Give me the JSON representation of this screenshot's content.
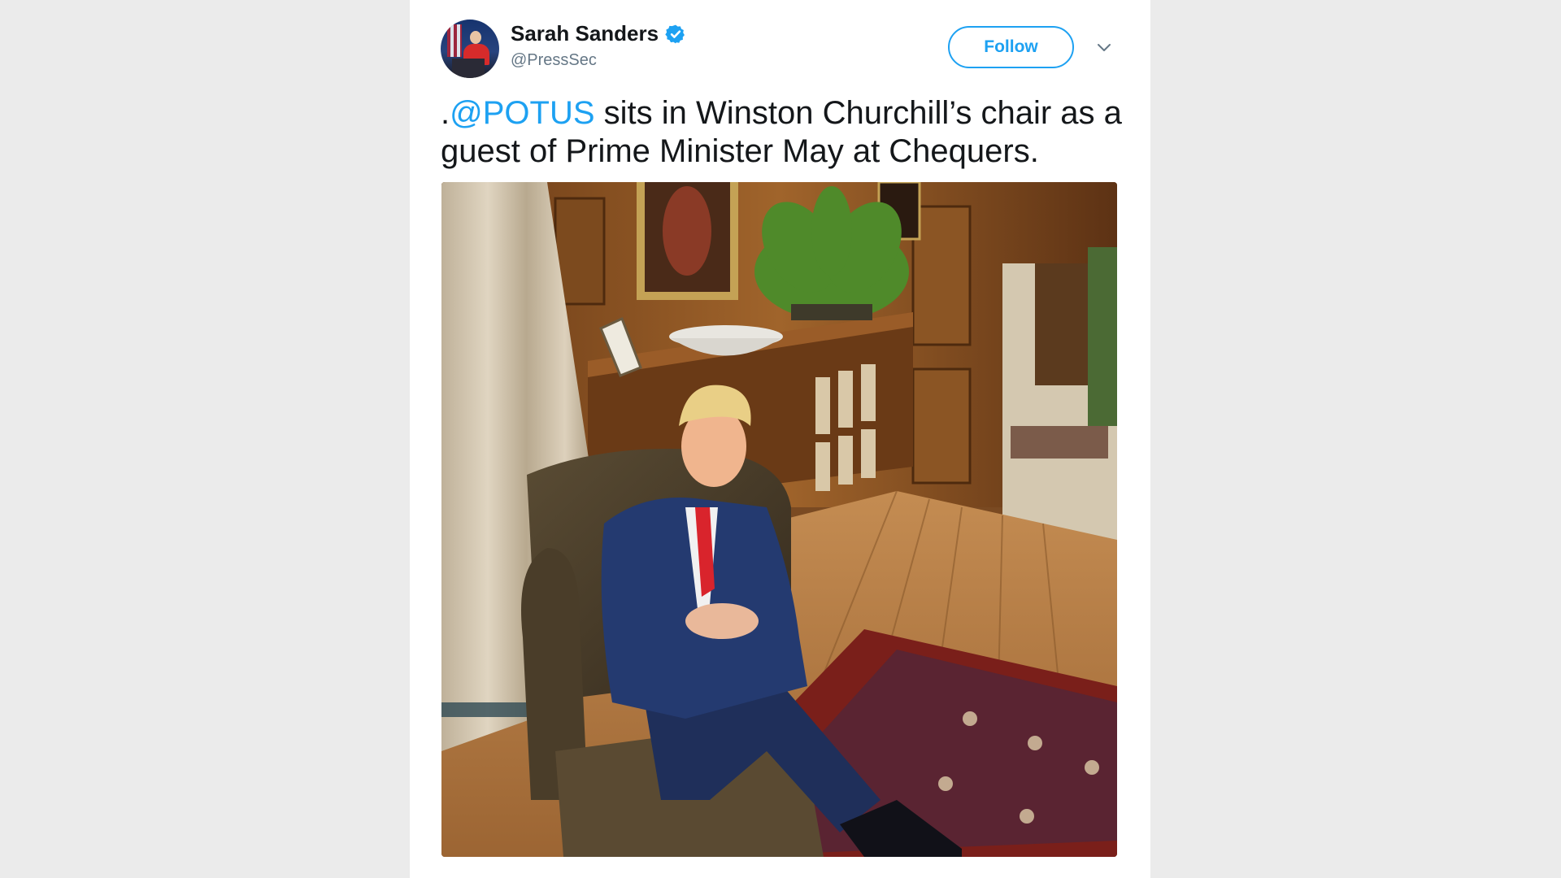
{
  "tweet": {
    "author": {
      "display_name": "Sarah Sanders",
      "handle": "@PressSec",
      "verified": true
    },
    "follow_label": "Follow",
    "text_prefix": ".",
    "mention": "@POTUS",
    "text_rest": " sits in Winston Churchill’s chair as a guest of Prime Minister May at Chequers.",
    "media": {
      "icon": "photo"
    }
  },
  "colors": {
    "brand_blue": "#1da1f2",
    "text": "#14171a",
    "secondary_text": "#657786",
    "background": "#ebebeb"
  }
}
